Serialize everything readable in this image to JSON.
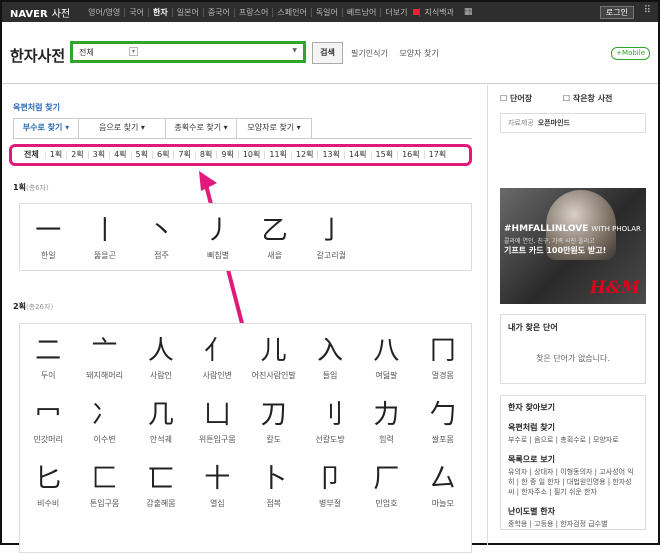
{
  "topbar": {
    "logo": "NAVER",
    "service": "사전",
    "nav": [
      "영어/영영",
      "국어",
      "한자",
      "일본어",
      "중국어",
      "프랑스어",
      "스페인어",
      "독일어",
      "베트남어",
      "더보기",
      "지식백과"
    ],
    "active_index": 2,
    "login_label": "로그인"
  },
  "header": {
    "title": "한자사전",
    "search": {
      "selected": "전체",
      "value": ""
    },
    "search_button": "검색",
    "links": [
      "필기인식기",
      "모양자 찾기"
    ],
    "mobile": "+Mobile"
  },
  "main": {
    "section_title": "옥편처럼 찾기",
    "tabs": [
      "부수로 찾기",
      "음으로 찾기",
      "총획수로 찾기",
      "모양자로 찾기"
    ],
    "active_tab": 0,
    "strokes": [
      "전체",
      "1획",
      "2획",
      "3획",
      "4획",
      "5획",
      "6획",
      "7획",
      "8획",
      "9획",
      "10획",
      "11획",
      "12획",
      "13획",
      "14획",
      "15획",
      "16획",
      "17획"
    ],
    "groups": [
      {
        "title": "1획",
        "count": "(총6자)",
        "rows": [
          [
            {
              "char": "一",
              "name": "한일"
            },
            {
              "char": "丨",
              "name": "뚫을곤"
            },
            {
              "char": "丶",
              "name": "점주"
            },
            {
              "char": "丿",
              "name": "삐침별"
            },
            {
              "char": "乙",
              "name": "새을"
            },
            {
              "char": "亅",
              "name": "갈고리궐"
            }
          ]
        ]
      },
      {
        "title": "2획",
        "count": "(총26자)",
        "rows": [
          [
            {
              "char": "二",
              "name": "두이"
            },
            {
              "char": "亠",
              "name": "돼지해머리"
            },
            {
              "char": "人",
              "name": "사람인"
            },
            {
              "char": "亻",
              "name": "사람인변"
            },
            {
              "char": "儿",
              "name": "어진사람인발"
            },
            {
              "char": "入",
              "name": "들입"
            },
            {
              "char": "八",
              "name": "여덟팔"
            },
            {
              "char": "冂",
              "name": "멀경몸"
            }
          ],
          [
            {
              "char": "冖",
              "name": "민갓머리"
            },
            {
              "char": "冫",
              "name": "이수변"
            },
            {
              "char": "几",
              "name": "안석궤"
            },
            {
              "char": "凵",
              "name": "위튼입구몸"
            },
            {
              "char": "刀",
              "name": "칼도"
            },
            {
              "char": "刂",
              "name": "선칼도방"
            },
            {
              "char": "力",
              "name": "힘력"
            },
            {
              "char": "勹",
              "name": "쌀포몸"
            }
          ],
          [
            {
              "char": "匕",
              "name": "비수비"
            },
            {
              "char": "匚",
              "name": "튼입구몸"
            },
            {
              "char": "匸",
              "name": "감출혜몸"
            },
            {
              "char": "十",
              "name": "열십"
            },
            {
              "char": "卜",
              "name": "점복"
            },
            {
              "char": "卩",
              "name": "병부절"
            },
            {
              "char": "厂",
              "name": "민엄호"
            },
            {
              "char": "厶",
              "name": "마늘모"
            }
          ]
        ]
      }
    ]
  },
  "sidebar": {
    "tabs": [
      "단어장",
      "작은창 사전"
    ],
    "supply_label": "자료제공",
    "supply_value": "오픈마인드",
    "ad": {
      "headline": "#HMFALLINLOVE",
      "brand_small": "WITH PHOLAR",
      "sub": "콜라에 연인, 친구, 가족 사진 올리고",
      "offer": "기프트 카드 100만원도 받고!",
      "logo": "H&M"
    },
    "recent_title": "내가 찾은 단어",
    "recent_empty": "찾은 단어가 없습니다.",
    "find_title": "한자 찾아보기",
    "find_groups": [
      {
        "title": "옥편처럼 찾기",
        "items": "부수로 | 음으로 | 총획수로 | 모양자로"
      },
      {
        "title": "목록으로 보기",
        "items": "유의자 | 상대자 | 이형동의자 | 고사성어 익히 | 한 중 일 한자 | 대법원인명용 | 한자성씨 | 한자주소 | 필기 쉬운 한자"
      },
      {
        "title": "난이도별 한자",
        "items": "중학용 | 고등용 | 한자검정 급수별"
      }
    ]
  }
}
